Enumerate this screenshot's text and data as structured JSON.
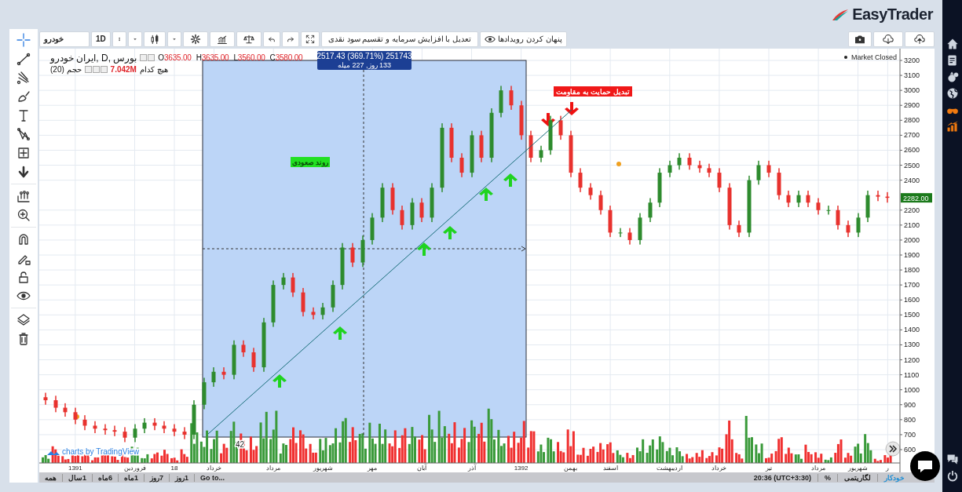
{
  "header": {
    "logo": "EasyTrader"
  },
  "toolbar": {
    "symbol": "خودرو",
    "interval": "1D",
    "adjust_button": "تعدیل با افزایش سرمایه و تقسیم سود نقدی",
    "events_button": "پنهان کردن رویدادها"
  },
  "drawing_tools": [
    {
      "kind": "crosshair",
      "selected": true
    },
    {
      "kind": "trend",
      "selected": false
    },
    {
      "kind": "fork",
      "selected": false
    },
    {
      "kind": "brush",
      "selected": false
    },
    {
      "kind": "text",
      "selected": false
    },
    {
      "kind": "pattern",
      "selected": false
    },
    {
      "kind": "projection",
      "selected": false
    },
    {
      "kind": "arrow",
      "selected": false
    },
    {
      "kind": "measure",
      "selected": false
    },
    {
      "kind": "zoom",
      "selected": false
    },
    {
      "kind": "magnet",
      "selected": false
    },
    {
      "kind": "pencil-lock",
      "selected": false
    },
    {
      "kind": "lock",
      "selected": false
    },
    {
      "kind": "eye",
      "selected": false
    },
    {
      "kind": "layers",
      "selected": false
    },
    {
      "kind": "trash",
      "selected": false
    }
  ],
  "legend": {
    "title": "ایران خودرو, D, بورس",
    "open": {
      "letter": "O",
      "price": "3635.00"
    },
    "high": {
      "letter": "H",
      "price": "3635.00"
    },
    "low": {
      "letter": "L",
      "price": "3560.00"
    },
    "close": {
      "letter": "C",
      "price": "3580.00"
    },
    "volume_label": "حجم (20)",
    "volume_value": "7.042M",
    "note": "هیچ کدام"
  },
  "market_status": "Market Closed",
  "measure": {
    "line_1": "2517.43 (369.71%) 251743",
    "line_2": "133 روز, 227 میله"
  },
  "labels": [
    {
      "text": "روند صعودی",
      "color": "#22e022"
    },
    {
      "text": "تبدیل حمایت به مقاومت",
      "color": "#f01818"
    }
  ],
  "range_percent": "42",
  "last_price": "2282.00",
  "attribution": "charts by TradingView",
  "chart_data": {
    "type": "candlestick",
    "grid": true,
    "ylim": [
      600,
      3200
    ],
    "yticks": [
      600,
      700,
      800,
      900,
      1000,
      1100,
      1200,
      1300,
      1400,
      1500,
      1600,
      1700,
      1800,
      1900,
      2000,
      2100,
      2200,
      2400,
      2500,
      2600,
      2700,
      2800,
      2900,
      3000,
      3100,
      3200
    ],
    "categories": [
      null,
      null,
      null,
      "1391",
      null,
      null,
      null,
      null,
      null,
      "فروردین",
      null,
      null,
      null,
      "18",
      null,
      null,
      null,
      "خرداد",
      null,
      null,
      null,
      null,
      null,
      "مرداد",
      null,
      null,
      null,
      null,
      "شهریور",
      null,
      null,
      null,
      null,
      "مهر",
      null,
      null,
      null,
      null,
      "آبان",
      null,
      null,
      null,
      null,
      "آذر",
      null,
      null,
      null,
      null,
      "1392",
      null,
      null,
      null,
      null,
      "بهمن",
      null,
      null,
      null,
      "اسفند",
      null,
      null,
      null,
      null,
      null,
      "اردیبهشت",
      null,
      null,
      null,
      null,
      "خرداد",
      null,
      null,
      null,
      null,
      "تیر",
      null,
      null,
      null,
      null,
      "مرداد",
      null,
      null,
      null,
      "شهریور",
      null,
      null,
      "ر"
    ],
    "ohlc": [
      [
        950,
        980,
        900,
        930
      ],
      [
        930,
        960,
        850,
        880
      ],
      [
        880,
        910,
        820,
        850
      ],
      [
        850,
        880,
        770,
        800
      ],
      [
        800,
        830,
        730,
        760
      ],
      [
        760,
        790,
        710,
        740
      ],
      [
        740,
        770,
        700,
        730
      ],
      [
        730,
        760,
        690,
        720
      ],
      [
        720,
        750,
        650,
        680
      ],
      [
        680,
        770,
        650,
        740
      ],
      [
        740,
        810,
        710,
        780
      ],
      [
        780,
        810,
        730,
        760
      ],
      [
        760,
        790,
        710,
        740
      ],
      [
        740,
        770,
        690,
        720
      ],
      [
        720,
        750,
        670,
        700
      ],
      [
        700,
        930,
        670,
        900
      ],
      [
        900,
        1080,
        870,
        1050
      ],
      [
        1050,
        1150,
        1020,
        1120
      ],
      [
        1120,
        1150,
        1070,
        1100
      ],
      [
        1100,
        1330,
        1070,
        1300
      ],
      [
        1300,
        1330,
        1220,
        1250
      ],
      [
        1250,
        1280,
        1120,
        1150
      ],
      [
        1150,
        1480,
        1120,
        1450
      ],
      [
        1450,
        1730,
        1420,
        1700
      ],
      [
        1700,
        1780,
        1670,
        1750
      ],
      [
        1750,
        1780,
        1620,
        1650
      ],
      [
        1650,
        1680,
        1490,
        1520
      ],
      [
        1520,
        1550,
        1470,
        1500
      ],
      [
        1500,
        1580,
        1470,
        1550
      ],
      [
        1550,
        1730,
        1520,
        1700
      ],
      [
        1700,
        1980,
        1670,
        1950
      ],
      [
        1950,
        1980,
        1820,
        1850
      ],
      [
        1850,
        2030,
        1820,
        2000
      ],
      [
        2000,
        2180,
        1970,
        2150
      ],
      [
        2150,
        2380,
        2120,
        2350
      ],
      [
        2350,
        2380,
        2170,
        2200
      ],
      [
        2200,
        2230,
        2070,
        2100
      ],
      [
        2100,
        2280,
        2070,
        2250
      ],
      [
        2250,
        2280,
        2120,
        2150
      ],
      [
        2150,
        2380,
        2120,
        2350
      ],
      [
        2350,
        2780,
        2320,
        2750
      ],
      [
        2750,
        2780,
        2520,
        2550
      ],
      [
        2550,
        2580,
        2420,
        2450
      ],
      [
        2450,
        2730,
        2420,
        2700
      ],
      [
        2700,
        2730,
        2520,
        2550
      ],
      [
        2550,
        2880,
        2520,
        2850
      ],
      [
        2850,
        3030,
        2820,
        3000
      ],
      [
        3000,
        3030,
        2870,
        2900
      ],
      [
        2900,
        2930,
        2670,
        2700
      ],
      [
        2700,
        2730,
        2520,
        2550
      ],
      [
        2550,
        2630,
        2520,
        2600
      ],
      [
        2600,
        2830,
        2570,
        2800
      ],
      [
        2800,
        2830,
        2670,
        2700
      ],
      [
        2700,
        2730,
        2420,
        2450
      ],
      [
        2450,
        2480,
        2320,
        2350
      ],
      [
        2350,
        2380,
        2270,
        2300
      ],
      [
        2300,
        2330,
        2170,
        2200
      ],
      [
        2200,
        2230,
        2020,
        2050
      ],
      [
        2050,
        2080,
        2020,
        2050
      ],
      [
        2050,
        2080,
        1970,
        2000
      ],
      [
        2000,
        2180,
        1970,
        2150
      ],
      [
        2150,
        2280,
        2120,
        2250
      ],
      [
        2250,
        2480,
        2220,
        2450
      ],
      [
        2450,
        2530,
        2420,
        2500
      ],
      [
        2500,
        2580,
        2470,
        2550
      ],
      [
        2550,
        2580,
        2470,
        2500
      ],
      [
        2500,
        2530,
        2450,
        2480
      ],
      [
        2480,
        2510,
        2420,
        2450
      ],
      [
        2450,
        2480,
        2320,
        2350
      ],
      [
        2350,
        2380,
        2070,
        2100
      ],
      [
        2100,
        2130,
        2020,
        2050
      ],
      [
        2050,
        2430,
        2020,
        2400
      ],
      [
        2400,
        2530,
        2370,
        2500
      ],
      [
        2500,
        2530,
        2420,
        2450
      ],
      [
        2450,
        2480,
        2270,
        2300
      ],
      [
        2300,
        2330,
        2220,
        2250
      ],
      [
        2250,
        2330,
        2220,
        2300
      ],
      [
        2300,
        2330,
        2220,
        2250
      ],
      [
        2250,
        2280,
        2170,
        2200
      ],
      [
        2200,
        2230,
        2170,
        2200
      ],
      [
        2200,
        2230,
        2070,
        2100
      ],
      [
        2100,
        2130,
        2020,
        2050
      ],
      [
        2050,
        2180,
        2020,
        2150
      ],
      [
        2150,
        2330,
        2120,
        2300
      ],
      [
        2300,
        2330,
        2260,
        2290
      ],
      [
        2290,
        2320,
        2250,
        2282
      ]
    ]
  },
  "range_buttons": [
    {
      "label": "...Go to"
    },
    {
      "label": "1روز"
    },
    {
      "label": "7روز"
    },
    {
      "label": "1ماه"
    },
    {
      "label": "6ماه"
    },
    {
      "label": "1سال"
    },
    {
      "label": "همه"
    }
  ],
  "status": {
    "options": [
      {
        "label": "خودکار",
        "selected": true
      },
      {
        "label": "لگاریتمی",
        "selected": false
      },
      {
        "label": "%",
        "selected": false
      }
    ],
    "time": "20:36 (UTC+3:30)"
  },
  "nav": [
    {
      "kind": "home",
      "highlighted": false
    },
    {
      "kind": "checklist",
      "highlighted": false
    },
    {
      "kind": "money",
      "highlighted": false
    },
    {
      "kind": "globe",
      "highlighted": false
    },
    {
      "kind": "binoculars",
      "highlighted": true
    },
    {
      "kind": "bars",
      "highlighted": true
    }
  ],
  "nav_bottom": [
    {
      "kind": "chat",
      "highlighted": false
    },
    {
      "kind": "power",
      "highlighted": false
    }
  ]
}
